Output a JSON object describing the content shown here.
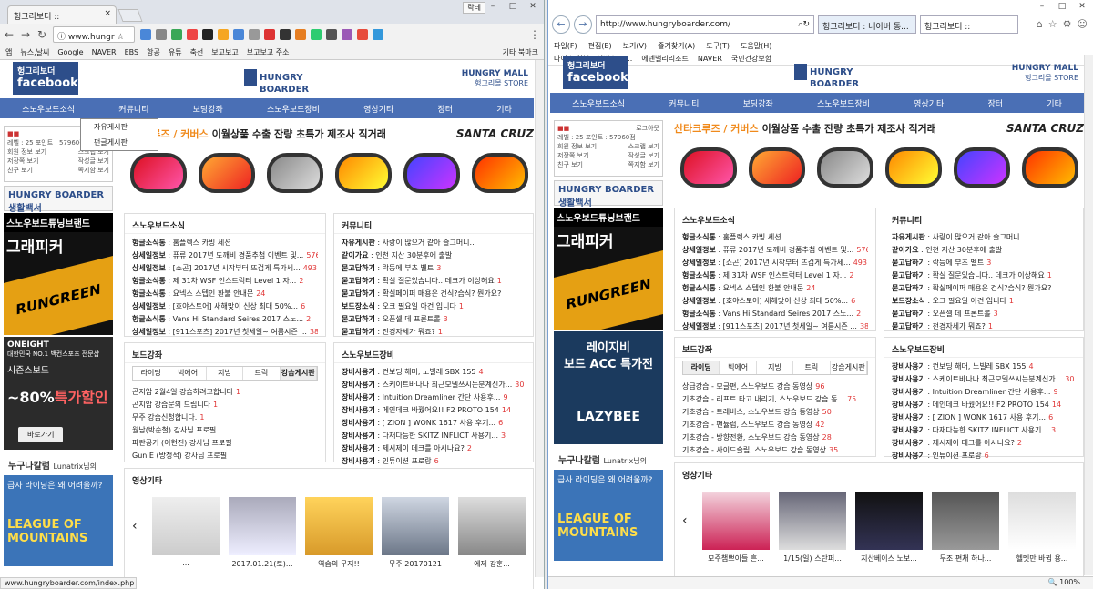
{
  "chrome": {
    "tab_title": "헝그리보더 ::",
    "user": "락테",
    "url": "www.hungr",
    "bookmarks": [
      "앱",
      "뉴스,날씨",
      "Google",
      "NAVER",
      "EBS",
      "항공",
      "유튜",
      "축선",
      "보고보고",
      "보고보고 주소"
    ],
    "other_bookmarks": "기타 북마크",
    "status_url": "www.hungryboarder.com/index.php"
  },
  "ie": {
    "url": "http://www.hungryboarder.com/",
    "tab1": "헝그리보더 : 네이버 통...",
    "tab2": "헝그리보더 ::",
    "menu": [
      "파일(F)",
      "편집(E)",
      "보기(V)",
      "즐겨찾기(A)",
      "도구(T)",
      "도움말(H)"
    ],
    "favs": [
      "나이스 학부모서비스 로...",
      "에덴밸리리조트",
      "NAVER",
      "국민건강보험"
    ],
    "zoom": "100%"
  },
  "site": {
    "fb": [
      "헝그리보더",
      "facebook"
    ],
    "hb_logo": [
      "HUNGRY",
      "BOARDER"
    ],
    "mall": [
      "HUNGRY MALL",
      "헝그리몰 STORE"
    ],
    "nav": [
      "스노우보드소식",
      "커뮤니티",
      "보딩강좌",
      "스노우보드장비",
      "영상기타",
      "장터",
      "기타"
    ],
    "dropdown": [
      "자유게시판",
      "펀글게시판"
    ],
    "login": {
      "level": "레벨 : 25",
      "point": "포인트 : 57960점",
      "items": [
        "회원 정보 보기",
        "스크랩 보기",
        "저장쪽 보기",
        "작성글 보기",
        "친구 보기",
        "쪽지함 보기"
      ],
      "btn": "로그아웃"
    },
    "hb_box": "HUNGRY BOARDER 생활백서",
    "ad_black": [
      "스노우보드튜닝브랜드",
      "그래피커",
      "RUNGREEN"
    ],
    "ad_one": [
      "ONEIGHT",
      "대한민국 NO.1 백컨스포츠 전문샵",
      "시즌스보드",
      "~80%",
      "특가할인",
      "바로가기"
    ],
    "ad_lazybee": [
      "레이지비",
      "보드 ACC 특가전",
      "LAZYBEE"
    ],
    "nu_col": "누구나칼럼",
    "nu_name": "Lunatrix님의",
    "ad_lg": [
      "급사 라이딩은",
      "왜 어려울까?",
      "LEAGUE OF MOUNTAINS"
    ],
    "banner": [
      "산타크루즈 / 커버스",
      "이월상품 수출 잔량 초특가 제조사 직거래",
      "SANTA CRUZ"
    ],
    "news": {
      "title": "스노우보드소식",
      "items": [
        {
          "t": "헝글소식통",
          "s": "홈플렉스 카빙 세션",
          "n": ""
        },
        {
          "t": "상세일정보",
          "s": "퓨류 2017년 도깨비 경품추첨 이벤트 및...",
          "n": "576"
        },
        {
          "t": "상세일정보",
          "s": "[쇼곤] 2017년 시작부터 뜨겁게 특가세...",
          "n": "493"
        },
        {
          "t": "헝글소식통",
          "s": "제 31차 WSF 인스트럭터 Level 1 자...",
          "n": "2"
        },
        {
          "t": "헝글소식통",
          "s": "요넥스 스텝인 환불 안내문",
          "n": "24"
        },
        {
          "t": "상세일정보",
          "s": "[호야스토어] 새해맞이 신상 최대 50%...",
          "n": "6"
        },
        {
          "t": "헝글소식통",
          "s": "Vans Hi Standard Seires 2017 스노...",
          "n": "2"
        },
        {
          "t": "상세일정보",
          "s": "[911스포츠] 2017년 첫세일~ 여름시즌 ...",
          "n": "384"
        }
      ]
    },
    "comm": {
      "title": "커뮤니티",
      "items": [
        {
          "t": "자유게시판",
          "s": "사랑이 많으거 같아 슬그머니..",
          "n": ""
        },
        {
          "t": "같이가요",
          "s": "인천 지산 30분후에 출발",
          "n": ""
        },
        {
          "t": "묻고답하기",
          "s": "락등에 부츠 벨트",
          "n": "3"
        },
        {
          "t": "묻고답하기",
          "s": "확실 질문있습니다.. 데크가 이상해요",
          "n": "1"
        },
        {
          "t": "묻고답하기",
          "s": "확실페이퍼 매용은 건식?습식? 뭔가요?",
          "n": ""
        },
        {
          "t": "보드장소식",
          "s": "오크 필요일 아건 입니다",
          "n": "1"
        },
        {
          "t": "묻고답하기",
          "s": "오픈셀 데 프론트롤",
          "n": "3"
        },
        {
          "t": "묻고답하기",
          "s": "전경자세가 뭐죠?",
          "n": "1"
        }
      ]
    },
    "lesson": {
      "title": "보드강좌",
      "tabs": [
        "라이딩",
        "빅에어",
        "지빙",
        "트릭",
        "강습게시판"
      ],
      "items_chrome": [
        {
          "s": "곤지암 2월4일 강습하려고합니다",
          "n": "1"
        },
        {
          "s": "곤지암 강습문의 드립니다",
          "n": "1"
        },
        {
          "s": "무주 강습신청합니다.",
          "n": "1"
        },
        {
          "s": "월남(박순철) 강사님 프로필",
          "n": ""
        },
        {
          "s": "파란공기 (이현진) 강사님 프로필",
          "n": ""
        },
        {
          "s": "Gun E (방정석) 강사님 프로필",
          "n": ""
        }
      ],
      "items_ie": [
        {
          "s": "상급강습 - 모글편, 스노우보드 강습 동영상",
          "n": "96"
        },
        {
          "s": "기초강습 - 리프트 타고 내리기, 스노우보드 강습 동...",
          "n": "75"
        },
        {
          "s": "기초강습 - 트래버스, 스노우보드 강습 동영상",
          "n": "50"
        },
        {
          "s": "기초강습 - 팬듈럼, 스노우보드 강습 동영상",
          "n": "42"
        },
        {
          "s": "기초강습 - 방향전환, 스노우보드 강습 동영상",
          "n": "28"
        },
        {
          "s": "기초강습 - 사이드슬립, 스노우보드 강습 동영상",
          "n": "35"
        }
      ]
    },
    "gear": {
      "title": "스노우보드장비",
      "items": [
        {
          "t": "장비사용기",
          "s": "컨보딩 해머, 노빌레 SBX 155",
          "n": "4"
        },
        {
          "t": "장비사용기",
          "s": "스케이트바나나 최근모델쓰시는분계신가...",
          "n": "30"
        },
        {
          "t": "장비사용기",
          "s": "Intuition Dreamliner 간단 사용후...",
          "n": "9"
        },
        {
          "t": "장비사용기",
          "s": "메인데크 바꿨어요!! F2 PROTO 154",
          "n": "14"
        },
        {
          "t": "장비사용기",
          "s": "[ ZION ] WONK 1617 사용 후기...",
          "n": "6"
        },
        {
          "t": "장비사용기",
          "s": "다재다능한 SKITZ INFLICT 사용기...",
          "n": "3"
        },
        {
          "t": "장비사용기",
          "s": "제시제이 데크를 아시나요?",
          "n": "2"
        },
        {
          "t": "장비사용기",
          "s": "인튜이션 프로랑",
          "n": "6"
        }
      ]
    },
    "video": {
      "title": "영상기타",
      "caps_chrome": [
        "...",
        "2017.01.21(토)...",
        "역습의 무지!!",
        "무주 20170121",
        "에제 강훈...",
        "교문 사진 9"
      ],
      "caps_ie": [
        "모주챔쁘이들 흔...",
        "1/15(일) 스탄퍼...",
        "지산베이스 노보...",
        "무조 편채 하나...",
        "헬멧만 바뀜 용..."
      ]
    },
    "prev": "‹",
    "next": "›"
  },
  "colors": {
    "nav": "#4a6fb5",
    "brand": "#2d4e8a",
    "accent": "#f08a1c"
  }
}
